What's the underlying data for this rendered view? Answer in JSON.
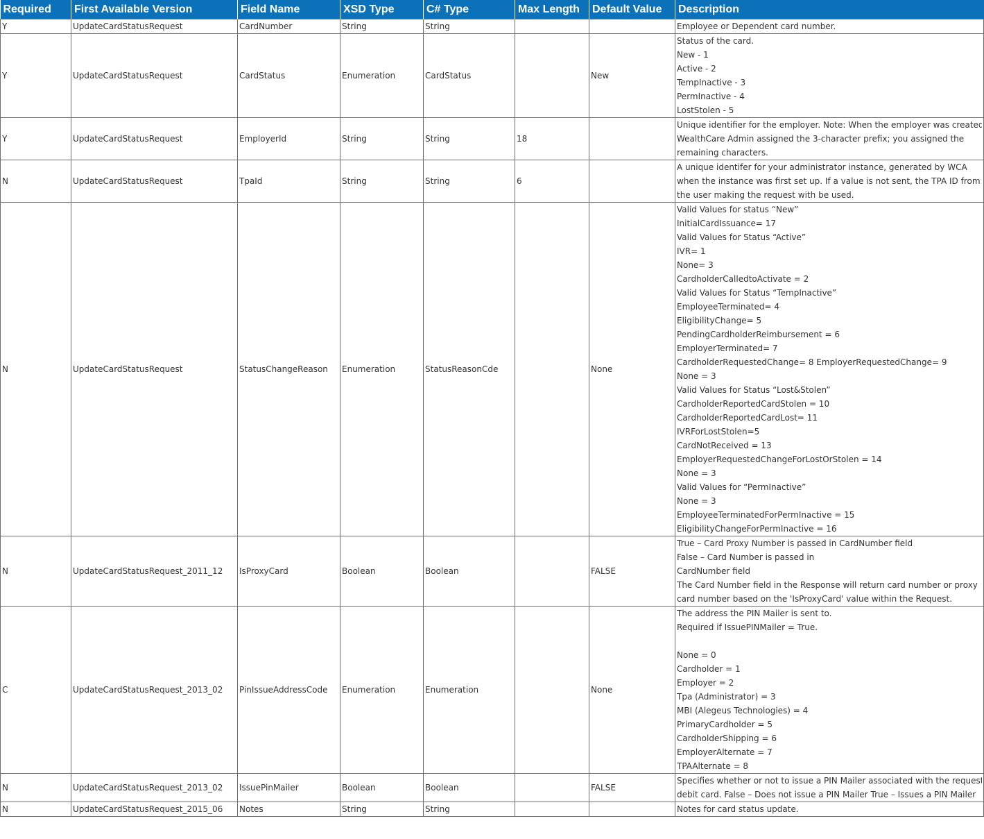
{
  "table": {
    "headers": [
      "Required",
      "First Available Version",
      "Field Name",
      "XSD Type",
      "C# Type",
      "Max Length",
      "Default Value",
      "Description"
    ],
    "rows": [
      {
        "required": "Y",
        "version": "UpdateCardStatusRequest",
        "field": "CardNumber",
        "xsd": "String",
        "csharp": "String",
        "maxlen": "",
        "default": "",
        "desc": [
          "Employee or Dependent card number."
        ]
      },
      {
        "required": "Y",
        "version": "UpdateCardStatusRequest",
        "field": "CardStatus",
        "xsd": "Enumeration",
        "csharp": "CardStatus",
        "maxlen": "",
        "default": "New",
        "desc": [
          "Status of the card.",
          "New - 1",
          "Active - 2",
          "TempInactive - 3",
          "PermInactive - 4",
          "LostStolen - 5"
        ]
      },
      {
        "required": "Y",
        "version": "UpdateCardStatusRequest",
        "field": "EmployerId",
        "xsd": "String",
        "csharp": "String",
        "maxlen": "18",
        "default": "",
        "desc": [
          "Unique identifier for the employer. Note: When the employer was created,",
          "WealthCare Admin assigned the 3-character prefix; you assigned the",
          "remaining characters."
        ]
      },
      {
        "required": "N",
        "version": "UpdateCardStatusRequest",
        "field": "TpaId",
        "xsd": "String",
        "csharp": "String",
        "maxlen": "6",
        "default": "",
        "desc": [
          "A unique identifer for your administrator instance, generated by WCA",
          "when the instance was first set up. If a value is not sent, the TPA ID from",
          "the user making the request with be used."
        ]
      },
      {
        "required": "N",
        "version": "UpdateCardStatusRequest",
        "field": "StatusChangeReason",
        "xsd": "Enumeration",
        "csharp": "StatusReasonCde",
        "maxlen": "",
        "default": "None",
        "desc": [
          "Valid Values for status “New”",
          "InitialCardIssuance= 17",
          "Valid Values for Status “Active”",
          "IVR= 1",
          "None= 3",
          "CardholderCalledtoActivate = 2",
          "Valid Values for Status “TempInactive”",
          "EmployeeTerminated= 4",
          "EligibilityChange= 5",
          "PendingCardholderReimbursement = 6",
          "EmployerTerminated= 7",
          "CardholderRequestedChange= 8 EmployerRequestedChange= 9",
          "None = 3",
          "Valid Values for Status “Lost&Stolen”",
          "CardholderReportedCardStolen = 10",
          "CardholderReportedCardLost= 11",
          "IVRForLostStolen=5",
          "CardNotReceived = 13",
          "EmployerRequestedChangeForLostOrStolen = 14",
          "None = 3",
          "Valid Values for “PermInactive”",
          "None = 3",
          "EmployeeTerminatedForPermInactive = 15",
          "EligibilityChangeForPermInactive = 16"
        ]
      },
      {
        "required": "N",
        "version": "UpdateCardStatusRequest_2011_12",
        "field": "IsProxyCard",
        "xsd": "Boolean",
        "csharp": "Boolean",
        "maxlen": "",
        "default": "FALSE",
        "desc": [
          "True – Card Proxy Number is passed in CardNumber field",
          "False – Card Number is passed in",
          "CardNumber field",
          "The Card Number field in the Response will return card number or proxy",
          "card number based on the 'IsProxyCard' value within the Request."
        ]
      },
      {
        "required": "C",
        "version": "UpdateCardStatusRequest_2013_02",
        "field": "PinIssueAddressCode",
        "xsd": "Enumeration",
        "csharp": "Enumeration",
        "maxlen": "",
        "default": "None",
        "desc": [
          "The address the PIN Mailer is sent to.",
          "Required if IssuePINMailer = True.",
          "",
          "None = 0",
          "Cardholder = 1",
          "Employer = 2",
          "Tpa (Administrator) = 3",
          "MBI (Alegeus Technologies) = 4",
          "PrimaryCardholder = 5",
          "CardholderShipping = 6",
          "EmployerAlternate  = 7",
          "TPAAlternate = 8"
        ]
      },
      {
        "required": "N",
        "version": "UpdateCardStatusRequest_2013_02",
        "field": "IssuePinMailer",
        "xsd": "Boolean",
        "csharp": "Boolean",
        "maxlen": "",
        "default": "FALSE",
        "desc": [
          "Specifies whether or not to issue a PIN Mailer associated with the request",
          "debit card. False – Does not issue a PIN Mailer True – Issues a PIN Mailer"
        ]
      },
      {
        "required": "N",
        "version": "UpdateCardStatusRequest_2015_06",
        "field": "Notes",
        "xsd": "String",
        "csharp": "String",
        "maxlen": "",
        "default": "",
        "desc": [
          "Notes for card status update."
        ]
      }
    ]
  }
}
